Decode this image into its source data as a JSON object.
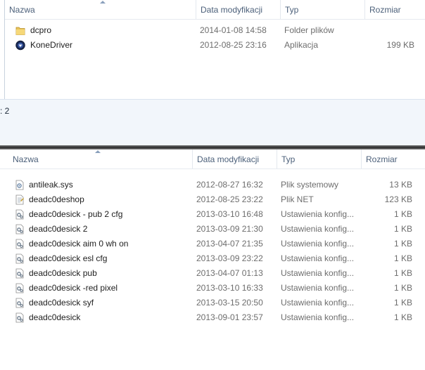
{
  "top": {
    "columns": {
      "name": "Nazwa",
      "date": "Data modyfikacji",
      "type": "Typ",
      "size": "Rozmiar"
    },
    "rows": [
      {
        "icon": "folder-icon",
        "name": "dcpro",
        "date": "2014-01-08 14:58",
        "type": "Folder plików",
        "size": ""
      },
      {
        "icon": "app-icon",
        "name": "KoneDriver",
        "date": "2012-08-25 23:16",
        "type": "Aplikacja",
        "size": "199 KB"
      }
    ]
  },
  "status": {
    "text": ": 2"
  },
  "bottom": {
    "columns": {
      "name": "Nazwa",
      "date": "Data modyfikacji",
      "type": "Typ",
      "size": "Rozmiar"
    },
    "rows": [
      {
        "icon": "system-file-icon",
        "name": "antileak.sys",
        "date": "2012-08-27 16:32",
        "type": "Plik systemowy",
        "size": "13 KB"
      },
      {
        "icon": "net-file-icon",
        "name": "deadc0deshop",
        "date": "2012-08-25 23:22",
        "type": "Plik NET",
        "size": "123 KB"
      },
      {
        "icon": "config-file-icon",
        "name": "deadc0desick - pub 2 cfg",
        "date": "2013-03-10 16:48",
        "type": "Ustawienia konfig...",
        "size": "1 KB"
      },
      {
        "icon": "config-file-icon",
        "name": "deadc0desick 2",
        "date": "2013-03-09 21:30",
        "type": "Ustawienia konfig...",
        "size": "1 KB"
      },
      {
        "icon": "config-file-icon",
        "name": "deadc0desick aim 0 wh on",
        "date": "2013-04-07 21:35",
        "type": "Ustawienia konfig...",
        "size": "1 KB"
      },
      {
        "icon": "config-file-icon",
        "name": "deadc0desick esl cfg",
        "date": "2013-03-09 23:22",
        "type": "Ustawienia konfig...",
        "size": "1 KB"
      },
      {
        "icon": "config-file-icon",
        "name": "deadc0desick pub",
        "date": "2013-04-07 01:13",
        "type": "Ustawienia konfig...",
        "size": "1 KB"
      },
      {
        "icon": "config-file-icon",
        "name": "deadc0desick -red pixel",
        "date": "2013-03-10 16:33",
        "type": "Ustawienia konfig...",
        "size": "1 KB"
      },
      {
        "icon": "config-file-icon",
        "name": "deadc0desick syf",
        "date": "2013-03-15 20:50",
        "type": "Ustawienia konfig...",
        "size": "1 KB"
      },
      {
        "icon": "config-file-icon",
        "name": "deadc0desick",
        "date": "2013-09-01 23:57",
        "type": "Ustawienia konfig...",
        "size": "1 KB"
      }
    ]
  }
}
